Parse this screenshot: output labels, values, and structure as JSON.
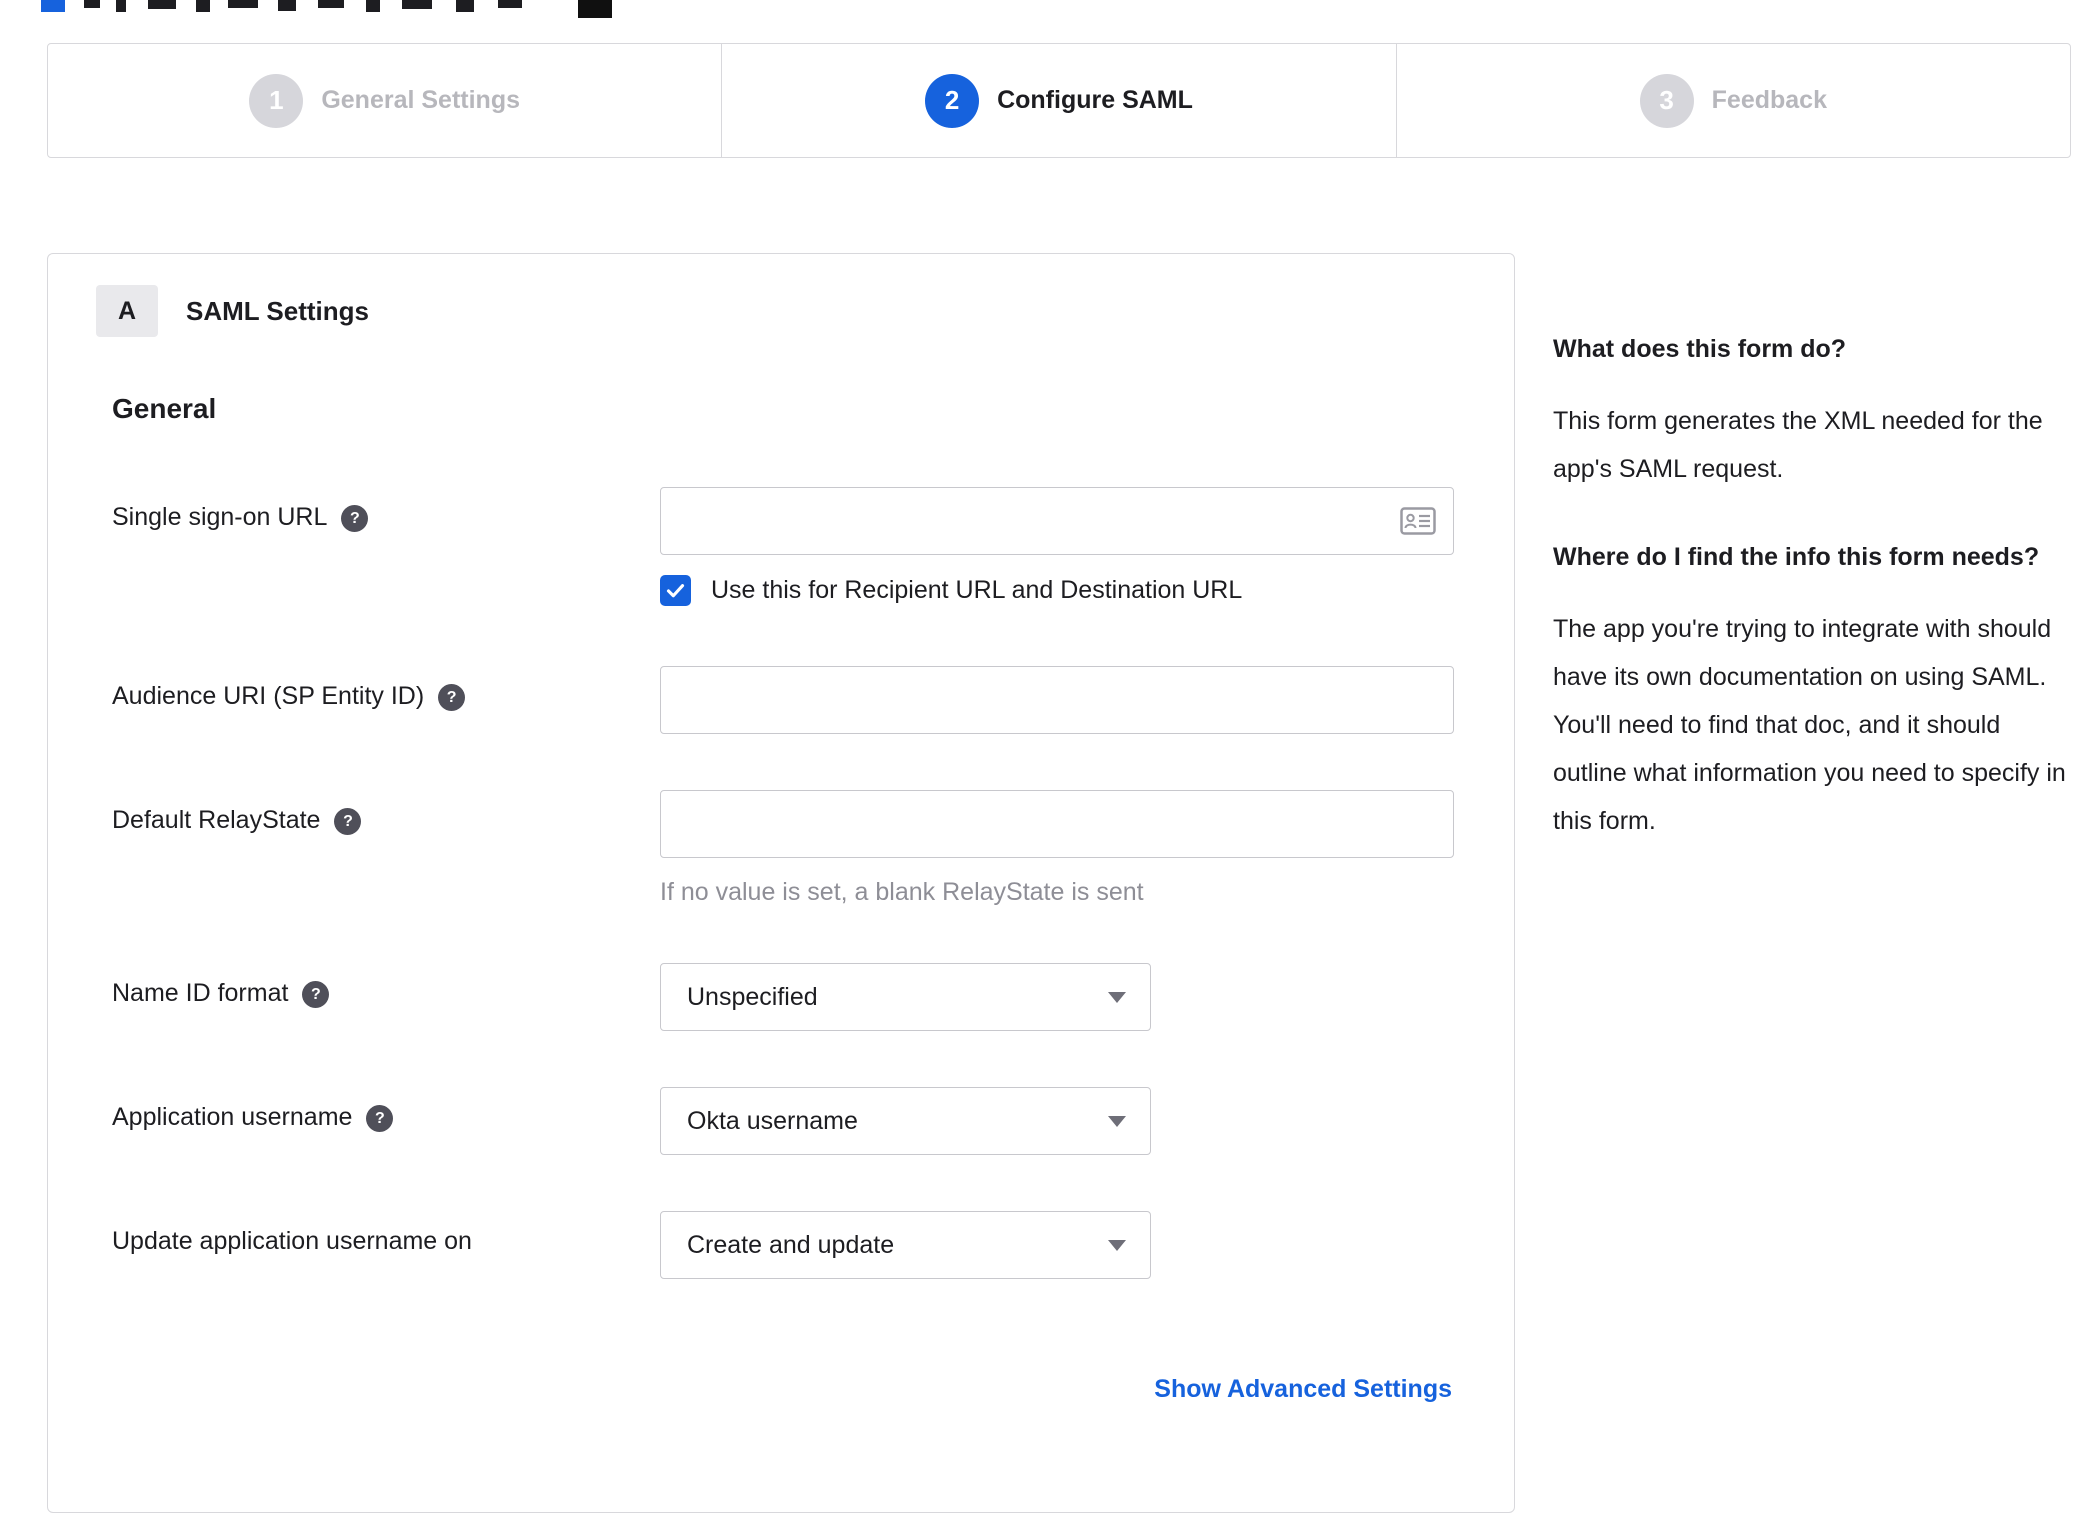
{
  "stepper": {
    "steps": [
      {
        "number": "1",
        "label": "General Settings",
        "state": "inactive"
      },
      {
        "number": "2",
        "label": "Configure SAML",
        "state": "active"
      },
      {
        "number": "3",
        "label": "Feedback",
        "state": "inactive"
      }
    ]
  },
  "panel": {
    "section_badge": "A",
    "section_title": "SAML Settings",
    "group_title": "General",
    "fields": {
      "sso_url": {
        "label": "Single sign-on URL",
        "value": ""
      },
      "sso_checkbox": {
        "label": "Use this for Recipient URL and Destination URL",
        "checked": true
      },
      "audience_uri": {
        "label": "Audience URI (SP Entity ID)",
        "value": ""
      },
      "relay_state": {
        "label": "Default RelayState",
        "value": "",
        "hint": "If no value is set, a blank RelayState is sent"
      },
      "name_id_format": {
        "label": "Name ID format",
        "value": "Unspecified"
      },
      "app_username": {
        "label": "Application username",
        "value": "Okta username"
      },
      "update_app_username": {
        "label": "Update application username on",
        "value": "Create and update"
      }
    },
    "advanced_link": "Show Advanced Settings"
  },
  "sidebar": {
    "q1": "What does this form do?",
    "a1": "This form generates the XML needed for the app's SAML request.",
    "q2": "Where do I find the info this form needs?",
    "a2": "The app you're trying to integrate with should have its own documentation on using SAML. You'll need to find that doc, and it should outline what information you need to specify in this form."
  },
  "icons": {
    "help": "?"
  },
  "colors": {
    "accent_blue": "#1662dd",
    "link_blue": "#1662dd",
    "inactive_gray": "#d6d6db",
    "border_gray": "#d8d8dc"
  }
}
